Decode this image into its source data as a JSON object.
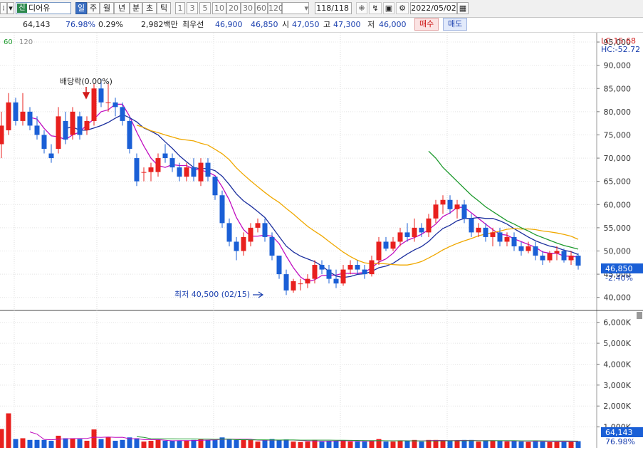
{
  "toolbar": {
    "stock_badge": "신",
    "stock_name": "디어유",
    "periods": [
      "일",
      "주",
      "월",
      "년",
      "분",
      "초",
      "틱"
    ],
    "intervals": [
      "1",
      "3",
      "5",
      "10",
      "20",
      "30",
      "60",
      "120"
    ],
    "count": "118",
    "total": "118",
    "date": "2022/05/02"
  },
  "info": {
    "volume": "64,143",
    "vol_rate": "76.98%",
    "turnover": "0.29%",
    "amount": "2,982백만",
    "label_best": "최우선",
    "best_ask": "46,900",
    "best_bid": "46,850",
    "label_open": "시",
    "open": "47,050",
    "label_high": "고",
    "high": "47,300",
    "label_low": "저",
    "low": "46,000",
    "buy_label": "매수",
    "sell_label": "매도"
  },
  "legend": {
    "ma60": "60",
    "ma120": "120",
    "lc": "LC:15.68",
    "hc": "HC:-52.72"
  },
  "annotations": {
    "dividend": "배당락(0.00%)",
    "low_mark": "최저 40,500 (02/15)",
    "current_price": "46,850",
    "current_change": "-2.40%",
    "current_volume": "64,143",
    "current_vol_pct": "76.98%"
  },
  "colors": {
    "up": "#e8201e",
    "down": "#1a5fd6",
    "ma5": "#c00ec0",
    "ma10": "#1c2f9e",
    "ma20": "#f0a800",
    "ma60": "#1e9a2e"
  },
  "chart_data": {
    "type": "candlestick",
    "price_axis": {
      "ticks": [
        "95,000",
        "90,000",
        "85,000",
        "80,000",
        "75,000",
        "70,000",
        "65,000",
        "60,000",
        "55,000",
        "50,000",
        "45,000",
        "40,000"
      ],
      "range": [
        37500,
        97000
      ]
    },
    "volume_axis": {
      "ticks": [
        "6,000K",
        "5,000K",
        "4,000K",
        "3,000K",
        "2,000K",
        "1,000K"
      ],
      "range": [
        0,
        6500000
      ]
    },
    "candles": [
      [
        73000,
        80000,
        70000,
        77000
      ],
      [
        76000,
        84000,
        75000,
        82000
      ],
      [
        82000,
        83000,
        77000,
        78000
      ],
      [
        78000,
        84000,
        77000,
        80000
      ],
      [
        80000,
        81000,
        76000,
        77000
      ],
      [
        77000,
        79000,
        74000,
        75000
      ],
      [
        75000,
        76000,
        71000,
        72000
      ],
      [
        71000,
        73000,
        69000,
        70000
      ],
      [
        72000,
        81000,
        71000,
        79000
      ],
      [
        78000,
        80000,
        73000,
        74000
      ],
      [
        75000,
        81000,
        74000,
        80000
      ],
      [
        79000,
        80000,
        74000,
        75000
      ],
      [
        76000,
        79000,
        75000,
        78000
      ],
      [
        78000,
        86000,
        77000,
        85000
      ],
      [
        85000,
        87000,
        81000,
        82000
      ],
      [
        82000,
        86000,
        80000,
        82000
      ],
      [
        82000,
        83000,
        79000,
        81000
      ],
      [
        81000,
        82000,
        77000,
        78000
      ],
      [
        78000,
        79000,
        71000,
        72000
      ],
      [
        70000,
        71000,
        64000,
        65000
      ],
      [
        67000,
        68000,
        65000,
        67000
      ],
      [
        67000,
        69000,
        65000,
        68000
      ],
      [
        67000,
        71000,
        66000,
        70000
      ],
      [
        71000,
        73000,
        69000,
        70000
      ],
      [
        70000,
        71000,
        67000,
        68000
      ],
      [
        68000,
        69000,
        65000,
        66000
      ],
      [
        66000,
        69000,
        65000,
        68000
      ],
      [
        68000,
        70000,
        65000,
        66000
      ],
      [
        65000,
        70000,
        64000,
        69000
      ],
      [
        69000,
        70000,
        65000,
        66000
      ],
      [
        66000,
        66000,
        61000,
        62000
      ],
      [
        62000,
        63000,
        55000,
        56000
      ],
      [
        56000,
        57000,
        51000,
        52000
      ],
      [
        52000,
        53000,
        48000,
        50000
      ],
      [
        50000,
        54000,
        49000,
        53000
      ],
      [
        52000,
        56000,
        51000,
        55000
      ],
      [
        55000,
        57000,
        54000,
        56000
      ],
      [
        56000,
        57000,
        52000,
        53000
      ],
      [
        53000,
        54000,
        48000,
        49000
      ],
      [
        49000,
        49000,
        44000,
        45000
      ],
      [
        45000,
        46000,
        40500,
        41500
      ],
      [
        41500,
        44000,
        41000,
        43500
      ],
      [
        43000,
        44000,
        41500,
        43000
      ],
      [
        43000,
        45000,
        42000,
        44000
      ],
      [
        44000,
        48000,
        43000,
        47000
      ],
      [
        47000,
        48000,
        45000,
        46000
      ],
      [
        46000,
        47000,
        43000,
        44000
      ],
      [
        44000,
        46000,
        42000,
        43000
      ],
      [
        43000,
        47000,
        42500,
        46000
      ],
      [
        46000,
        48000,
        45000,
        47000
      ],
      [
        47000,
        48000,
        45000,
        46000
      ],
      [
        46000,
        47000,
        44000,
        45000
      ],
      [
        45000,
        49000,
        44500,
        48000
      ],
      [
        48000,
        53000,
        47000,
        52000
      ],
      [
        52000,
        53000,
        50000,
        50500
      ],
      [
        50500,
        53000,
        50000,
        52000
      ],
      [
        52000,
        55000,
        51000,
        54000
      ],
      [
        54000,
        56000,
        52000,
        53000
      ],
      [
        53000,
        57000,
        52000,
        55000
      ],
      [
        55000,
        56000,
        53000,
        54000
      ],
      [
        54000,
        58000,
        53000,
        57000
      ],
      [
        57000,
        61000,
        56000,
        60000
      ],
      [
        60000,
        62000,
        58000,
        61000
      ],
      [
        61000,
        62000,
        58000,
        59000
      ],
      [
        59000,
        61000,
        57000,
        60000
      ],
      [
        60000,
        61000,
        56000,
        57000
      ],
      [
        57000,
        58000,
        53000,
        54000
      ],
      [
        54000,
        56000,
        53000,
        55000
      ],
      [
        55000,
        56000,
        52000,
        53000
      ],
      [
        53000,
        55000,
        51000,
        54000
      ],
      [
        54000,
        55000,
        51000,
        52000
      ],
      [
        52000,
        54000,
        51000,
        53000
      ],
      [
        53000,
        54000,
        50000,
        51000
      ],
      [
        51000,
        52000,
        49000,
        50000
      ],
      [
        50000,
        52000,
        49500,
        51000
      ],
      [
        51000,
        52000,
        48000,
        49000
      ],
      [
        49000,
        50000,
        47000,
        48000
      ],
      [
        48000,
        50000,
        47500,
        49500
      ],
      [
        49500,
        51000,
        48000,
        50000
      ],
      [
        50000,
        50500,
        47500,
        48000
      ],
      [
        48000,
        50000,
        47000,
        49000
      ],
      [
        49000,
        49500,
        46000,
        46850
      ]
    ],
    "series": [
      {
        "name": "60",
        "values": [
          null,
          null,
          null,
          null,
          null,
          null,
          null,
          null,
          null,
          null,
          null,
          null,
          null,
          null,
          null,
          null,
          null,
          null,
          null,
          null,
          null,
          null,
          null,
          null,
          null,
          null,
          null,
          null,
          null,
          null,
          null,
          null,
          null,
          null,
          null,
          null,
          null,
          null,
          null,
          null,
          null,
          null,
          null,
          null,
          null,
          null,
          null,
          null,
          null,
          null,
          null,
          null,
          null,
          null,
          null,
          null,
          null,
          null,
          null,
          null,
          71500,
          70000,
          68000,
          66500,
          65000,
          63500,
          62000,
          60800,
          59500,
          58500,
          57500,
          56500,
          55800,
          55000,
          54300,
          53500,
          52900,
          52300,
          51700,
          51200,
          50800,
          50400
        ]
      },
      {
        "name": "120",
        "values": []
      }
    ]
  }
}
